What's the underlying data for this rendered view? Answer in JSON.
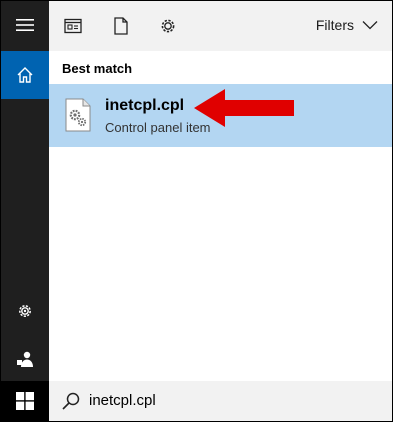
{
  "rail": {
    "menu_icon": "hamburger-icon",
    "home_icon": "home-icon",
    "settings_icon": "gear-icon",
    "user_icon": "user-icon",
    "start_icon": "windows-logo-icon"
  },
  "toolbar": {
    "icons": [
      "apps-icon",
      "document-icon",
      "gear-icon"
    ],
    "filters_label": "Filters"
  },
  "results": {
    "section_title": "Best match",
    "items": [
      {
        "name": "inetcpl.cpl",
        "subtitle": "Control panel item",
        "icon": "control-panel-file-icon"
      }
    ]
  },
  "annotation": {
    "type": "red-arrow-pointing-left",
    "color": "#e00000"
  },
  "search": {
    "query": "inetcpl.cpl"
  },
  "colors": {
    "rail_bg": "#1f1f1f",
    "rail_active": "#0063b1",
    "selection": "#b3d6f2",
    "panel_bg": "#f2f2f2"
  }
}
